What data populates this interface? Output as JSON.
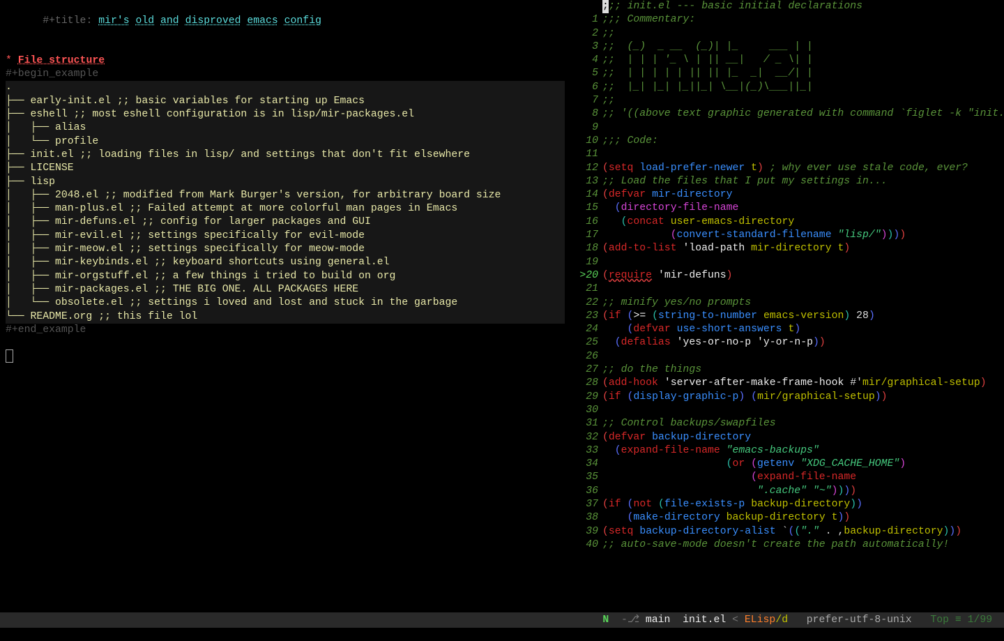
{
  "left": {
    "titlePrefix": "#+title: ",
    "titleWords": [
      "mir's",
      "old",
      "and",
      "disproved",
      "emacs",
      "config"
    ],
    "heading": "File structure",
    "begin": "#+begin_example",
    "end": "#+end_example",
    "tree": [
      ".",
      "├── early-init.el ;; basic variables for starting up Emacs",
      "├── eshell ;; most eshell configuration is in lisp/mir-packages.el",
      "│   ├── alias",
      "│   └── profile",
      "├── init.el ;; loading files in lisp/ and settings that don't fit elsewhere",
      "├── LICENSE",
      "├── lisp",
      "│   ├── 2048.el ;; modified from Mark Burger's version, for arbitrary board size",
      "│   ├── man-plus.el ;; Failed attempt at more colorful man pages in Emacs",
      "│   ├── mir-defuns.el ;; config for larger packages and GUI",
      "│   ├── mir-evil.el ;; settings specifically for evil-mode",
      "│   ├── mir-meow.el ;; settings specifically for meow-mode",
      "│   ├── mir-keybinds.el ;; keyboard shortcuts using general.el",
      "│   ├── mir-orgstuff.el ;; a few things i tried to build on org",
      "│   ├── mir-packages.el ;; THE BIG ONE. ALL PACKAGES HERE",
      "│   └── obsolete.el ;; settings i loved and lost and stuck in the garbage",
      "└── README.org ;; this file lol"
    ]
  },
  "right": {
    "topBadge": "1",
    "lines": [
      {
        "n": "",
        "tokens": [
          [
            "cursor",
            ";"
          ],
          [
            "c-comment",
            ";; init.el --- basic initial declarations"
          ]
        ]
      },
      {
        "n": "1",
        "tokens": [
          [
            "c-comment",
            ";;; Commentary:"
          ]
        ]
      },
      {
        "n": "2",
        "tokens": [
          [
            "c-comment",
            ";;"
          ]
        ]
      },
      {
        "n": "3",
        "tokens": [
          [
            "c-comment",
            ";;  (_)  _ __  (_)| |_     ___ | |"
          ]
        ]
      },
      {
        "n": "4",
        "tokens": [
          [
            "c-comment",
            ";;  | | | '_ \\ | || __|   / _ \\| |"
          ]
        ]
      },
      {
        "n": "5",
        "tokens": [
          [
            "c-comment",
            ";;  | | | | | || || |_  _|  __/| |"
          ]
        ]
      },
      {
        "n": "6",
        "tokens": [
          [
            "c-comment",
            ";;  |_| |_| |_||_| \\__|(_)\\___||_|"
          ]
        ]
      },
      {
        "n": "7",
        "tokens": [
          [
            "c-comment",
            ";;"
          ]
        ]
      },
      {
        "n": "8",
        "tokens": [
          [
            "c-comment",
            ";; '((above text graphic generated with command `figlet -k \"init.el\"'))"
          ]
        ]
      },
      {
        "n": "9",
        "tokens": []
      },
      {
        "n": "10",
        "tokens": [
          [
            "c-comment",
            ";;; Code:"
          ]
        ]
      },
      {
        "n": "11",
        "tokens": []
      },
      {
        "n": "12",
        "tokens": [
          [
            "c-paren",
            "("
          ],
          [
            "c-kw",
            "setq"
          ],
          [
            "",
            " "
          ],
          [
            "c-var",
            "load-prefer-newer"
          ],
          [
            "",
            " "
          ],
          [
            "c-type",
            "t"
          ],
          [
            "c-paren",
            ")"
          ],
          [
            "",
            " "
          ],
          [
            "c-comment",
            "; why ever use stale code, ever?"
          ]
        ]
      },
      {
        "n": "13",
        "tokens": [
          [
            "c-comment",
            ";; Load the files that I put my settings in..."
          ]
        ]
      },
      {
        "n": "14",
        "tokens": [
          [
            "c-paren",
            "("
          ],
          [
            "c-kw",
            "defvar"
          ],
          [
            "",
            " "
          ],
          [
            "c-var",
            "mir-directory"
          ]
        ]
      },
      {
        "n": "15",
        "tokens": [
          [
            "",
            "  "
          ],
          [
            "c-paren2",
            "("
          ],
          [
            "c-mag",
            "directory-file-name"
          ]
        ]
      },
      {
        "n": "16",
        "tokens": [
          [
            "",
            "   "
          ],
          [
            "c-paren3",
            "("
          ],
          [
            "c-kw",
            "concat"
          ],
          [
            "",
            " "
          ],
          [
            "c-type",
            "user-emacs-directory"
          ]
        ]
      },
      {
        "n": "17",
        "tokens": [
          [
            "",
            "           "
          ],
          [
            "c-paren4",
            "("
          ],
          [
            "c-var",
            "convert-standard-filename"
          ],
          [
            "",
            " "
          ],
          [
            "c-str",
            "\"lisp/\""
          ],
          [
            "c-paren4",
            ")"
          ],
          [
            "c-paren3",
            ")"
          ],
          [
            "c-paren2",
            ")"
          ],
          [
            "c-paren",
            ")"
          ]
        ]
      },
      {
        "n": "18",
        "tokens": [
          [
            "c-paren",
            "("
          ],
          [
            "c-kw",
            "add-to-list"
          ],
          [
            "",
            " "
          ],
          [
            "c-fn",
            "'load-path"
          ],
          [
            "",
            " "
          ],
          [
            "c-type",
            "mir-directory"
          ],
          [
            "",
            " "
          ],
          [
            "c-type",
            "t"
          ],
          [
            "c-paren",
            ")"
          ]
        ]
      },
      {
        "n": "19",
        "tokens": []
      },
      {
        "n": "20",
        "mark": ">",
        "tokens": [
          [
            "c-paren",
            "("
          ],
          [
            "c-kw ul",
            "require"
          ],
          [
            "",
            " "
          ],
          [
            "c-fn",
            "'mir-defuns"
          ],
          [
            "c-paren",
            ")"
          ]
        ]
      },
      {
        "n": "21",
        "tokens": []
      },
      {
        "n": "22",
        "tokens": [
          [
            "c-comment",
            ";; minify yes/no prompts"
          ]
        ]
      },
      {
        "n": "23",
        "tokens": [
          [
            "c-paren",
            "("
          ],
          [
            "c-kw",
            "if"
          ],
          [
            "",
            " "
          ],
          [
            "c-paren2",
            "("
          ],
          [
            "c-fn",
            ">="
          ],
          [
            "",
            " "
          ],
          [
            "c-paren3",
            "("
          ],
          [
            "c-var",
            "string-to-number"
          ],
          [
            "",
            " "
          ],
          [
            "c-type",
            "emacs-version"
          ],
          [
            "c-paren3",
            ")"
          ],
          [
            "",
            " "
          ],
          [
            "c-num",
            "28"
          ],
          [
            "c-paren2",
            ")"
          ]
        ]
      },
      {
        "n": "24",
        "tokens": [
          [
            "",
            "    "
          ],
          [
            "c-paren2",
            "("
          ],
          [
            "c-kw",
            "defvar"
          ],
          [
            "",
            " "
          ],
          [
            "c-var",
            "use-short-answers"
          ],
          [
            "",
            " "
          ],
          [
            "c-type",
            "t"
          ],
          [
            "c-paren2",
            ")"
          ]
        ]
      },
      {
        "n": "25",
        "tokens": [
          [
            "",
            "  "
          ],
          [
            "c-paren2",
            "("
          ],
          [
            "c-kw",
            "defalias"
          ],
          [
            "",
            " "
          ],
          [
            "c-fn",
            "'yes-or-no-p"
          ],
          [
            "",
            " "
          ],
          [
            "c-fn",
            "'y-or-n-p"
          ],
          [
            "c-paren2",
            ")"
          ],
          [
            "c-paren",
            ")"
          ]
        ]
      },
      {
        "n": "26",
        "tokens": []
      },
      {
        "n": "27",
        "tokens": [
          [
            "c-comment",
            ";; do the things"
          ]
        ]
      },
      {
        "n": "28",
        "tokens": [
          [
            "c-paren",
            "("
          ],
          [
            "c-kw",
            "add-hook"
          ],
          [
            "",
            " "
          ],
          [
            "c-fn",
            "'server-after-make-frame-hook"
          ],
          [
            "",
            " #'"
          ],
          [
            "c-type",
            "mir/graphical-setup"
          ],
          [
            "c-paren",
            ")"
          ]
        ]
      },
      {
        "n": "29",
        "tokens": [
          [
            "c-paren",
            "("
          ],
          [
            "c-kw",
            "if"
          ],
          [
            "",
            " "
          ],
          [
            "c-paren2",
            "("
          ],
          [
            "c-var",
            "display-graphic-p"
          ],
          [
            "c-paren2",
            ")"
          ],
          [
            "",
            " "
          ],
          [
            "c-paren2",
            "("
          ],
          [
            "c-type",
            "mir/graphical-setup"
          ],
          [
            "c-paren2",
            ")"
          ],
          [
            "c-paren",
            ")"
          ]
        ]
      },
      {
        "n": "30",
        "tokens": []
      },
      {
        "n": "31",
        "tokens": [
          [
            "c-comment",
            ";; Control backups/swapfiles"
          ]
        ]
      },
      {
        "n": "32",
        "tokens": [
          [
            "c-paren",
            "("
          ],
          [
            "c-kw",
            "defvar"
          ],
          [
            "",
            " "
          ],
          [
            "c-var",
            "backup-directory"
          ]
        ]
      },
      {
        "n": "33",
        "tokens": [
          [
            "",
            "  "
          ],
          [
            "c-paren2",
            "("
          ],
          [
            "c-kw",
            "expand-file-name"
          ],
          [
            "",
            " "
          ],
          [
            "c-str",
            "\"emacs-backups\""
          ]
        ]
      },
      {
        "n": "34",
        "tokens": [
          [
            "",
            "                    "
          ],
          [
            "c-paren3",
            "("
          ],
          [
            "c-kw",
            "or"
          ],
          [
            "",
            " "
          ],
          [
            "c-paren4",
            "("
          ],
          [
            "c-var",
            "getenv"
          ],
          [
            "",
            " "
          ],
          [
            "c-str",
            "\"XDG_CACHE_HOME\""
          ],
          [
            "c-paren4",
            ")"
          ]
        ]
      },
      {
        "n": "35",
        "tokens": [
          [
            "",
            "                        "
          ],
          [
            "c-paren4",
            "("
          ],
          [
            "c-kw",
            "expand-file-name"
          ]
        ]
      },
      {
        "n": "36",
        "tokens": [
          [
            "",
            "                         "
          ],
          [
            "c-str",
            "\".cache\""
          ],
          [
            "",
            " "
          ],
          [
            "c-str",
            "\"~\""
          ],
          [
            "c-paren4",
            ")"
          ],
          [
            "c-paren3",
            ")"
          ],
          [
            "c-paren2",
            ")"
          ],
          [
            "c-paren",
            ")"
          ]
        ]
      },
      {
        "n": "37",
        "tokens": [
          [
            "c-paren",
            "("
          ],
          [
            "c-kw",
            "if"
          ],
          [
            "",
            " "
          ],
          [
            "c-paren2",
            "("
          ],
          [
            "c-kw",
            "not"
          ],
          [
            "",
            " "
          ],
          [
            "c-paren3",
            "("
          ],
          [
            "c-var",
            "file-exists-p"
          ],
          [
            "",
            " "
          ],
          [
            "c-type",
            "backup-directory"
          ],
          [
            "c-paren3",
            ")"
          ],
          [
            "c-paren2",
            ")"
          ]
        ]
      },
      {
        "n": "38",
        "tokens": [
          [
            "",
            "    "
          ],
          [
            "c-paren2",
            "("
          ],
          [
            "c-var",
            "make-directory"
          ],
          [
            "",
            " "
          ],
          [
            "c-type",
            "backup-directory"
          ],
          [
            "",
            " "
          ],
          [
            "c-type",
            "t"
          ],
          [
            "c-paren2",
            ")"
          ],
          [
            "c-paren",
            ")"
          ]
        ]
      },
      {
        "n": "39",
        "tokens": [
          [
            "c-paren",
            "("
          ],
          [
            "c-kw",
            "setq"
          ],
          [
            "",
            " "
          ],
          [
            "c-var",
            "backup-directory-alist"
          ],
          [
            "",
            " `"
          ],
          [
            "c-paren2",
            "("
          ],
          [
            "c-paren3",
            "("
          ],
          [
            "c-str",
            "\".\""
          ],
          [
            "",
            " . ,"
          ],
          [
            "c-type",
            "backup-directory"
          ],
          [
            "c-paren3",
            ")"
          ],
          [
            "c-paren2",
            ")"
          ],
          [
            "c-paren",
            ")"
          ]
        ]
      },
      {
        "n": "40",
        "tokens": [
          [
            "c-comment",
            ";; auto-save-mode doesn't create the path automatically!"
          ]
        ]
      }
    ]
  },
  "modeline": {
    "N": "N",
    "branch": " main ",
    "file": " init.el ",
    "mode1": " ELisp",
    "mode2": "/d ",
    "enc": "  prefer-utf-8-unix  ",
    "pos": " Top ≡ 1/99 "
  }
}
